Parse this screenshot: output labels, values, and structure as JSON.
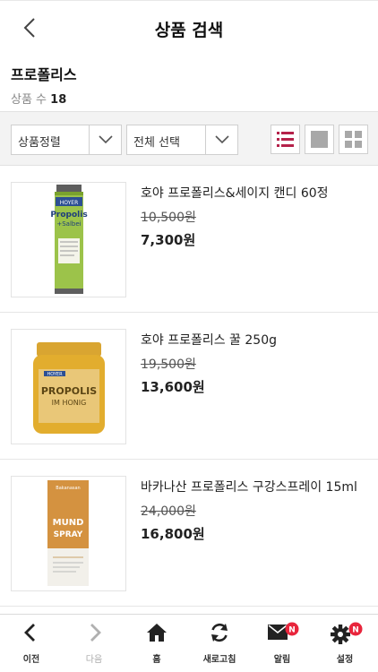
{
  "header": {
    "title": "상품 검색",
    "back_icon": "chevron-left-icon"
  },
  "search": {
    "keyword": "프로폴리스",
    "count_label": "상품 수",
    "count": "18"
  },
  "toolbar": {
    "sort_label": "상품정렬",
    "filter_label": "전체 선택",
    "accent_color": "#b5224a"
  },
  "products": [
    {
      "name": "호야 프로폴리스&세이지 캔디 60정",
      "original_price": "10,500원",
      "sale_price": "7,300원",
      "image_text": {
        "brand": "HOYER",
        "title": "Propolis",
        "subtitle": "+Salbei"
      }
    },
    {
      "name": "호야 프로폴리스 꿀 250g",
      "original_price": "19,500원",
      "sale_price": "13,600원",
      "image_text": {
        "brand": "HOYER",
        "title": "PROPOLIS",
        "subtitle": "IM HONIG"
      }
    },
    {
      "name": "바카나산 프로폴리스 구강스프레이 15ml",
      "original_price": "24,000원",
      "sale_price": "16,800원",
      "image_text": {
        "brand": "Bakanasan",
        "title": "MUND",
        "subtitle": "SPRAY"
      }
    }
  ],
  "bottom_nav": [
    {
      "label": "이전",
      "icon": "back-icon"
    },
    {
      "label": "다음",
      "icon": "forward-icon"
    },
    {
      "label": "홈",
      "icon": "home-icon"
    },
    {
      "label": "새로고침",
      "icon": "refresh-icon"
    },
    {
      "label": "알림",
      "icon": "mail-icon",
      "badge": "N"
    },
    {
      "label": "설정",
      "icon": "gear-icon",
      "badge": "N"
    }
  ]
}
